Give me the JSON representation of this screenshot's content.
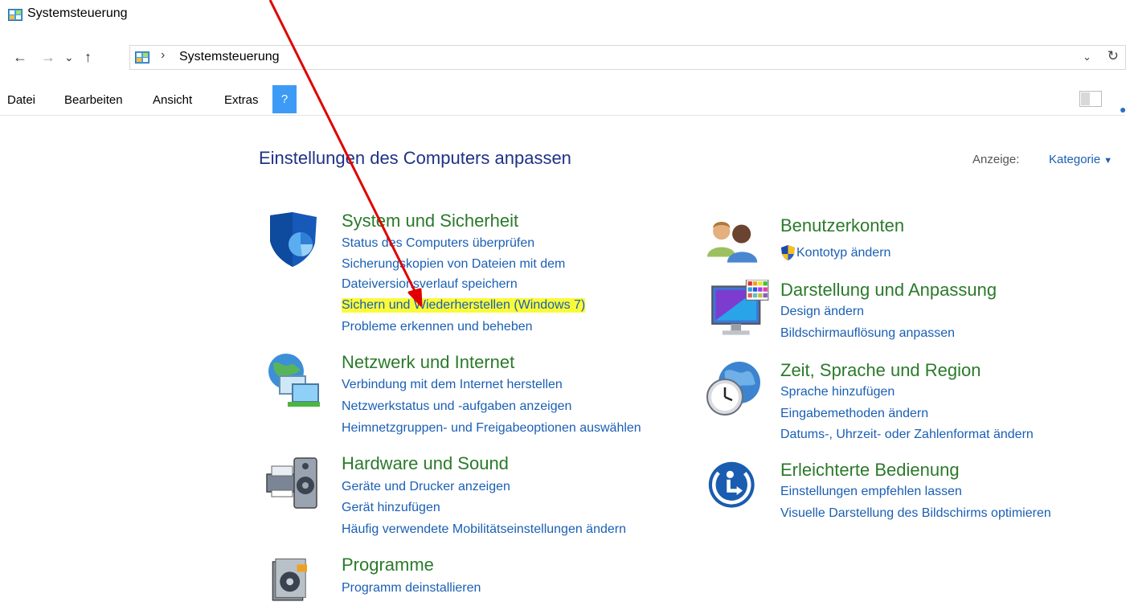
{
  "window": {
    "title": "Systemsteuerung",
    "icon": "control-panel-icon"
  },
  "address": {
    "breadcrumb": "Systemsteuerung",
    "separator": "›",
    "icons": {
      "back": "←",
      "forward": "→",
      "recent": "⌄",
      "up": "↑",
      "dropdown": "⌄",
      "refresh": "↻"
    }
  },
  "menu": {
    "items": [
      "Datei",
      "Bearbeiten",
      "Ansicht",
      "Extras"
    ],
    "help": "?"
  },
  "main": {
    "heading": "Einstellungen des Computers anpassen",
    "view_label": "Anzeige:",
    "view_value": "Kategorie",
    "view_arrow": "▼"
  },
  "categories": {
    "system": {
      "title": "System und Sicherheit",
      "links": [
        "Status des Computers überprüfen",
        "Sicherungskopien von Dateien mit dem",
        "Dateiversionsverlauf speichern",
        "Sichern und Wiederherstellen (Windows 7)",
        "Probleme erkennen und beheben"
      ]
    },
    "network": {
      "title": "Netzwerk und Internet",
      "links": [
        "Verbindung mit dem Internet herstellen",
        "Netzwerkstatus und -aufgaben anzeigen",
        "Heimnetzgruppen- und Freigabeoptionen auswählen"
      ]
    },
    "hardware": {
      "title": "Hardware und Sound",
      "links": [
        "Geräte und Drucker anzeigen",
        "Gerät hinzufügen",
        "Häufig verwendete Mobilitätseinstellungen ändern"
      ]
    },
    "programs": {
      "title": "Programme",
      "links": [
        "Programm deinstallieren"
      ]
    },
    "users": {
      "title": "Benutzerkonten",
      "links": [
        "Kontotyp ändern"
      ]
    },
    "appearance": {
      "title": "Darstellung und Anpassung",
      "links": [
        "Design ändern",
        "Bildschirmauflösung anpassen"
      ]
    },
    "clock": {
      "title": "Zeit, Sprache und Region",
      "links": [
        "Sprache hinzufügen",
        "Eingabemethoden ändern",
        "Datums-, Uhrzeit- oder Zahlenformat ändern"
      ]
    },
    "ease": {
      "title": "Erleichterte Bedienung",
      "links": [
        "Einstellungen empfehlen lassen",
        "Visuelle Darstellung des Bildschirms optimieren"
      ]
    }
  },
  "colors": {
    "heading": "#1e3287",
    "category_title": "#2b7a2b",
    "link": "#1a5fb4",
    "highlight": "#fafa3a",
    "annotation_arrow": "#e00000",
    "help_menu_bg": "#3d9bf5"
  }
}
